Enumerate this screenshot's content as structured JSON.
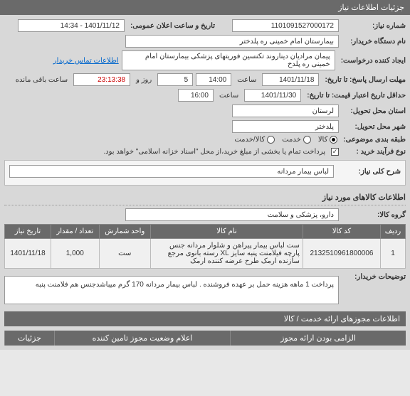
{
  "header": {
    "title": "جزئیات اطلاعات نیاز"
  },
  "fields": {
    "need_number_label": "شماره نیاز:",
    "need_number": "1101091527000172",
    "announce_label": "تاریخ و ساعت اعلان عمومی:",
    "announce_value": "1401/11/12 - 14:34",
    "buyer_label": "نام دستگاه خریدار:",
    "buyer_value": "بیمارستان امام خمینی ره پلدختر",
    "requester_label": "ایجاد کننده درخواست:",
    "requester_value": "پیمان مرادیان دیناروند تکنسین فوریتهای پزشکی بیمارستان امام خمینی ره پلدخ",
    "contact_link": "اطلاعات تماس خریدار",
    "deadline_label": "مهلت ارسال پاسخ: تا تاریخ:",
    "deadline_date": "1401/11/18",
    "hour_label": "ساعت",
    "deadline_hour": "14:00",
    "day_count": "5",
    "day_and": "روز و",
    "remaining": "23:13:38",
    "remaining_label": "ساعت باقی مانده",
    "validity_label": "حداقل تاریخ اعتبار قیمت: تا تاریخ:",
    "validity_date": "1401/11/30",
    "validity_hour": "16:00",
    "province_label": "استان محل تحویل:",
    "province_value": "لرستان",
    "city_label": "شهر محل تحویل:",
    "city_value": "پلدختر",
    "budget_label": "طبقه بندی موضوعی:",
    "budget_goods": "کالا",
    "budget_service": "خدمت",
    "budget_both": "کالا/خدمت",
    "buy_type_label": "نوع فرآیند خرید :",
    "buy_type_note": "پرداخت تمام یا بخشی از مبلغ خرید،از محل \"اسناد خزانه اسلامی\" خواهد بود."
  },
  "summary": {
    "label": "شرح کلی نیاز:",
    "text": "لباس بیمار مردانه"
  },
  "goods_section": {
    "title": "اطلاعات کالاهای مورد نیاز",
    "group_label": "گروه کالا:",
    "group_value": "دارو، پزشکی و سلامت"
  },
  "table": {
    "headers": {
      "row": "ردیف",
      "code": "کد کالا",
      "name": "نام کالا",
      "unit": "واحد شمارش",
      "qty": "تعداد / مقدار",
      "date": "تاریخ نیاز"
    },
    "rows": [
      {
        "row": "1",
        "code": "2132510961800006",
        "name": "ست لباس بیمار پیراهن و شلوار مردانه جنس پارچه فیلامنت پنبه سایز XL رسته بانوی مرجع سازنده ارمک طرح عرضه کننده ارمک",
        "unit": "ست",
        "qty": "1,000",
        "date": "1401/11/18"
      }
    ]
  },
  "buyer_notes": {
    "label": "توضیحات خریدار:",
    "text": "پرداخت 1 ماهه هزینه حمل بر عهده فروشنده . لباس بیمار مردانه 170 گرم میباشدجنس هم فلامنت پنبه"
  },
  "accordion": {
    "permits": "اطلاعات مجوزهای ارائه خدمت / کالا",
    "status": "اعلام وضعیت مجوز تامین کننده",
    "required": "الزامی بودن ارائه مجوز",
    "details": "جزئیات"
  }
}
